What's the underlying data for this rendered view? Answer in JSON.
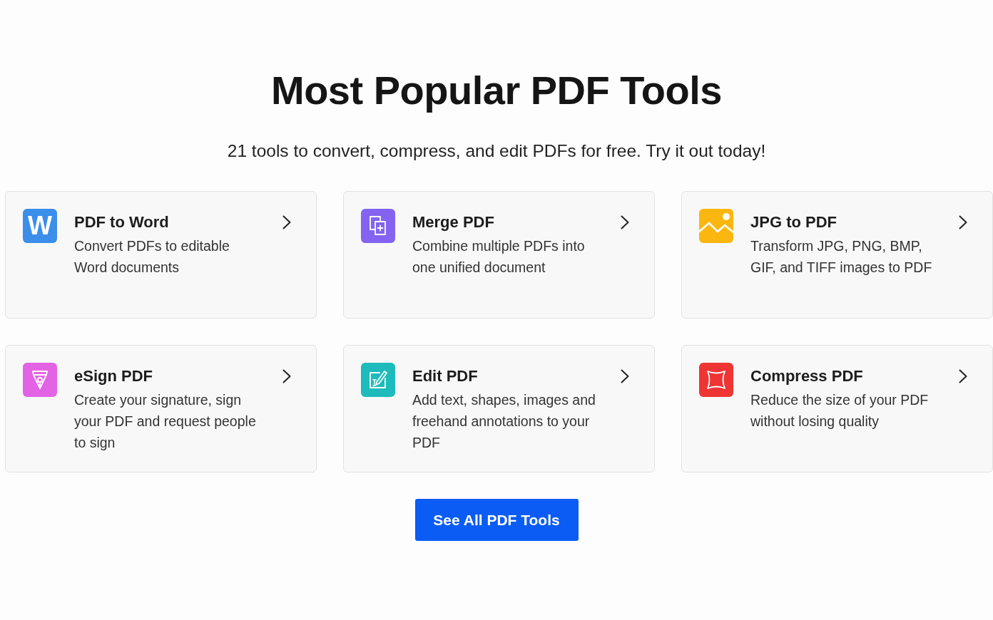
{
  "heading": "Most Popular PDF Tools",
  "subheading": "21 tools to convert, compress, and edit PDFs for free. Try it out today!",
  "tools": [
    {
      "kind": "word",
      "icon_letter": "W",
      "color": "#3b8eea",
      "title": "PDF to Word",
      "description": "Convert PDFs to editable\nWord documents"
    },
    {
      "kind": "merge",
      "color": "#8363f0",
      "title": "Merge PDF",
      "description": "Combine multiple PDFs into\none unified document"
    },
    {
      "kind": "image",
      "color": "#fbb70f",
      "title": "JPG to PDF",
      "description": "Transform JPG, PNG, BMP,\nGIF, and TIFF images to PDF"
    },
    {
      "kind": "sign",
      "color": "#e263e4",
      "title": "eSign PDF",
      "description": "Create your signature, sign\nyour PDF and request people\nto sign"
    },
    {
      "kind": "edit",
      "color": "#1dbbbb",
      "title": "Edit PDF",
      "description": "Add text, shapes, images and\nfreehand annotations to your\nPDF"
    },
    {
      "kind": "compress",
      "color": "#ef3534",
      "title": "Compress PDF",
      "description": "Reduce the size of your PDF\nwithout losing quality"
    }
  ],
  "cta": {
    "label": "See All PDF Tools"
  }
}
